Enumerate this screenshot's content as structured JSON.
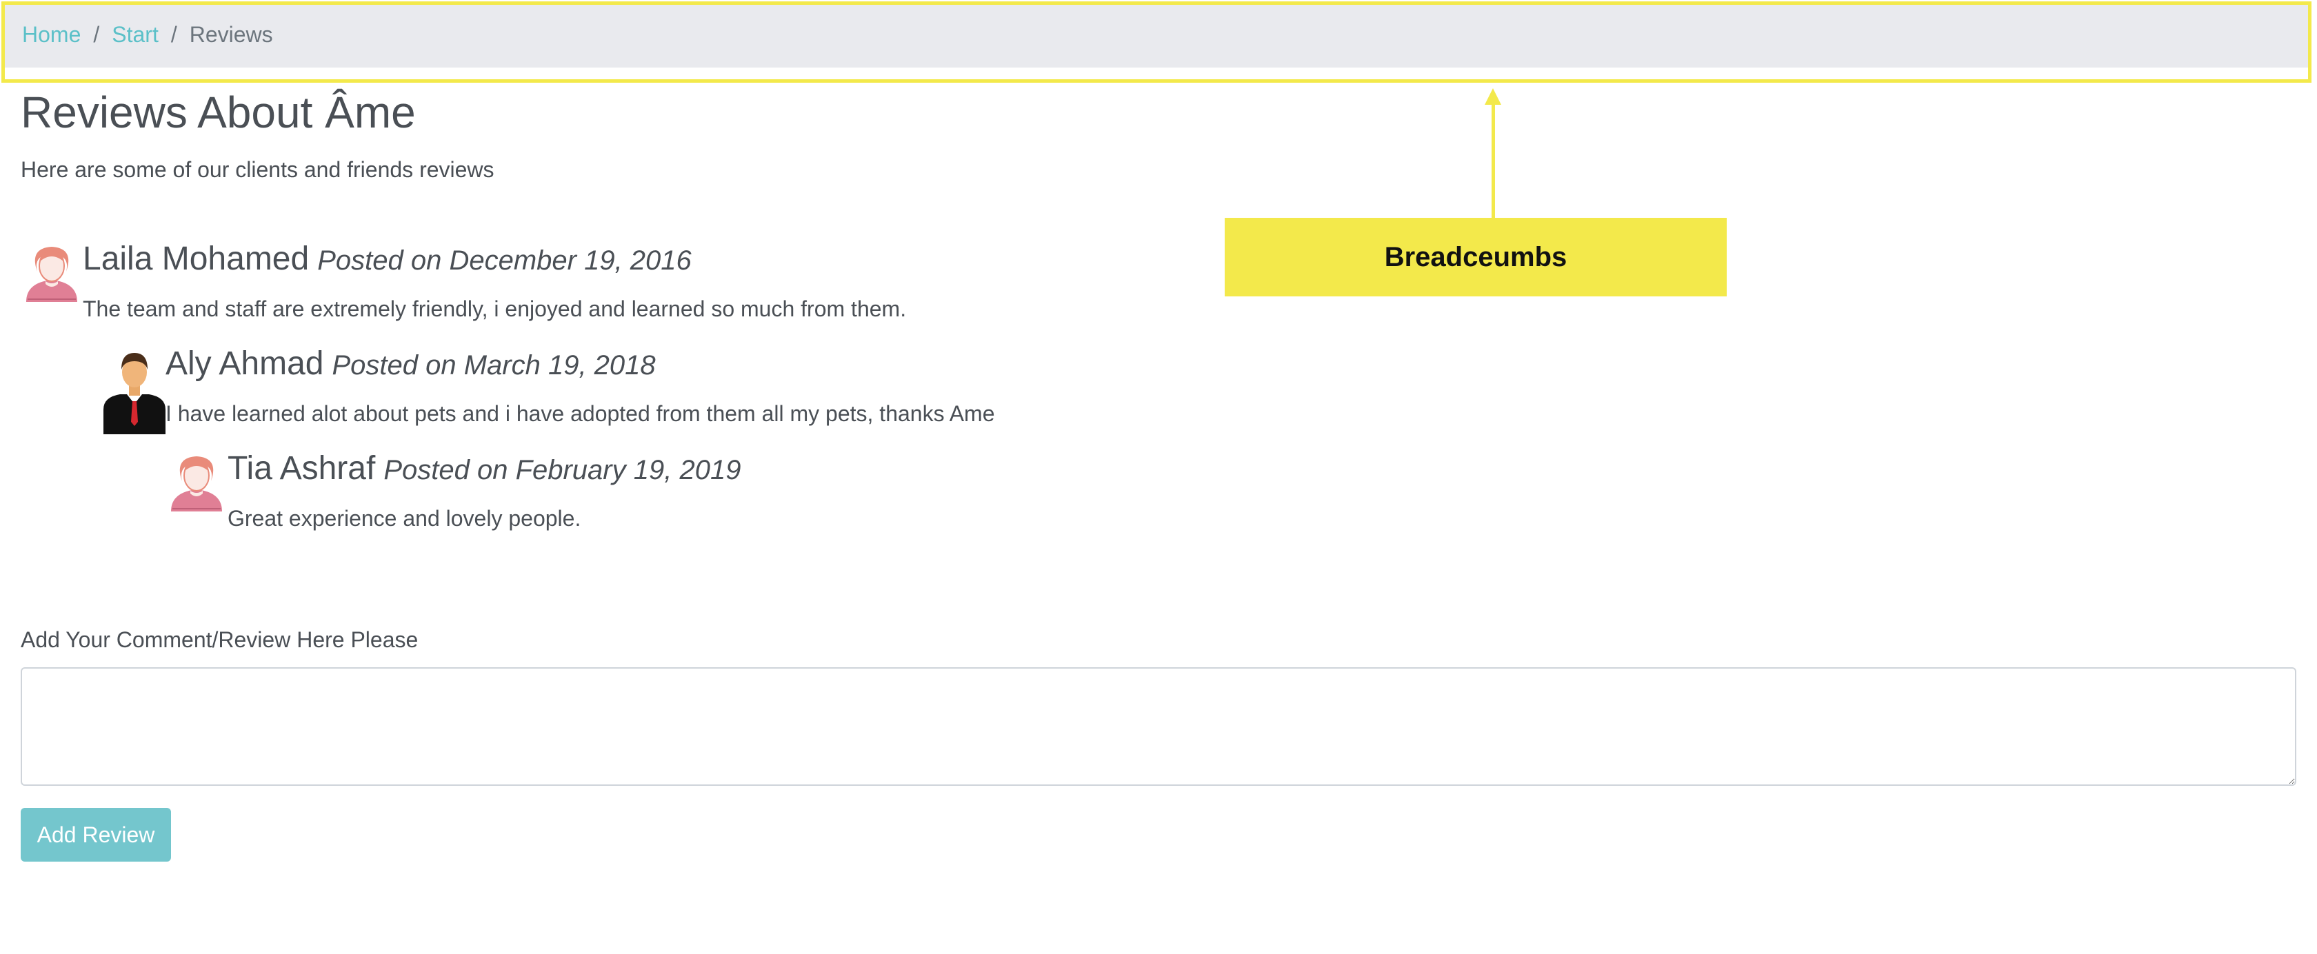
{
  "breadcrumb": {
    "items": [
      {
        "label": "Home",
        "link": true
      },
      {
        "label": "Start",
        "link": true
      },
      {
        "label": "Reviews",
        "link": false
      }
    ],
    "separator": "/"
  },
  "annotation": {
    "label": "Breadceumbs",
    "color": "#f3e94b"
  },
  "page": {
    "title": "Reviews About Âme",
    "subtitle": "Here are some of our clients and friends reviews"
  },
  "reviews": [
    {
      "name": "Laila Mohamed",
      "date": "Posted on December 19, 2016",
      "text": "The team and staff are extremely friendly, i enjoyed and learned so much from them.",
      "avatar": "female-avatar-icon"
    },
    {
      "name": "Aly Ahmad",
      "date": "Posted on March 19, 2018",
      "text": "I have learned alot about pets and i have adopted from them all my pets, thanks Ame",
      "avatar": "male-avatar-icon"
    },
    {
      "name": "Tia Ashraf",
      "date": "Posted on February 19, 2019",
      "text": "Great experience and lovely people.",
      "avatar": "female-avatar-icon"
    }
  ],
  "form": {
    "label": "Add Your Comment/Review Here Please",
    "value": "",
    "submit_label": "Add Review"
  },
  "colors": {
    "accent": "#5bc0c8",
    "button": "#74c6cd",
    "highlight": "#f3e94b"
  }
}
